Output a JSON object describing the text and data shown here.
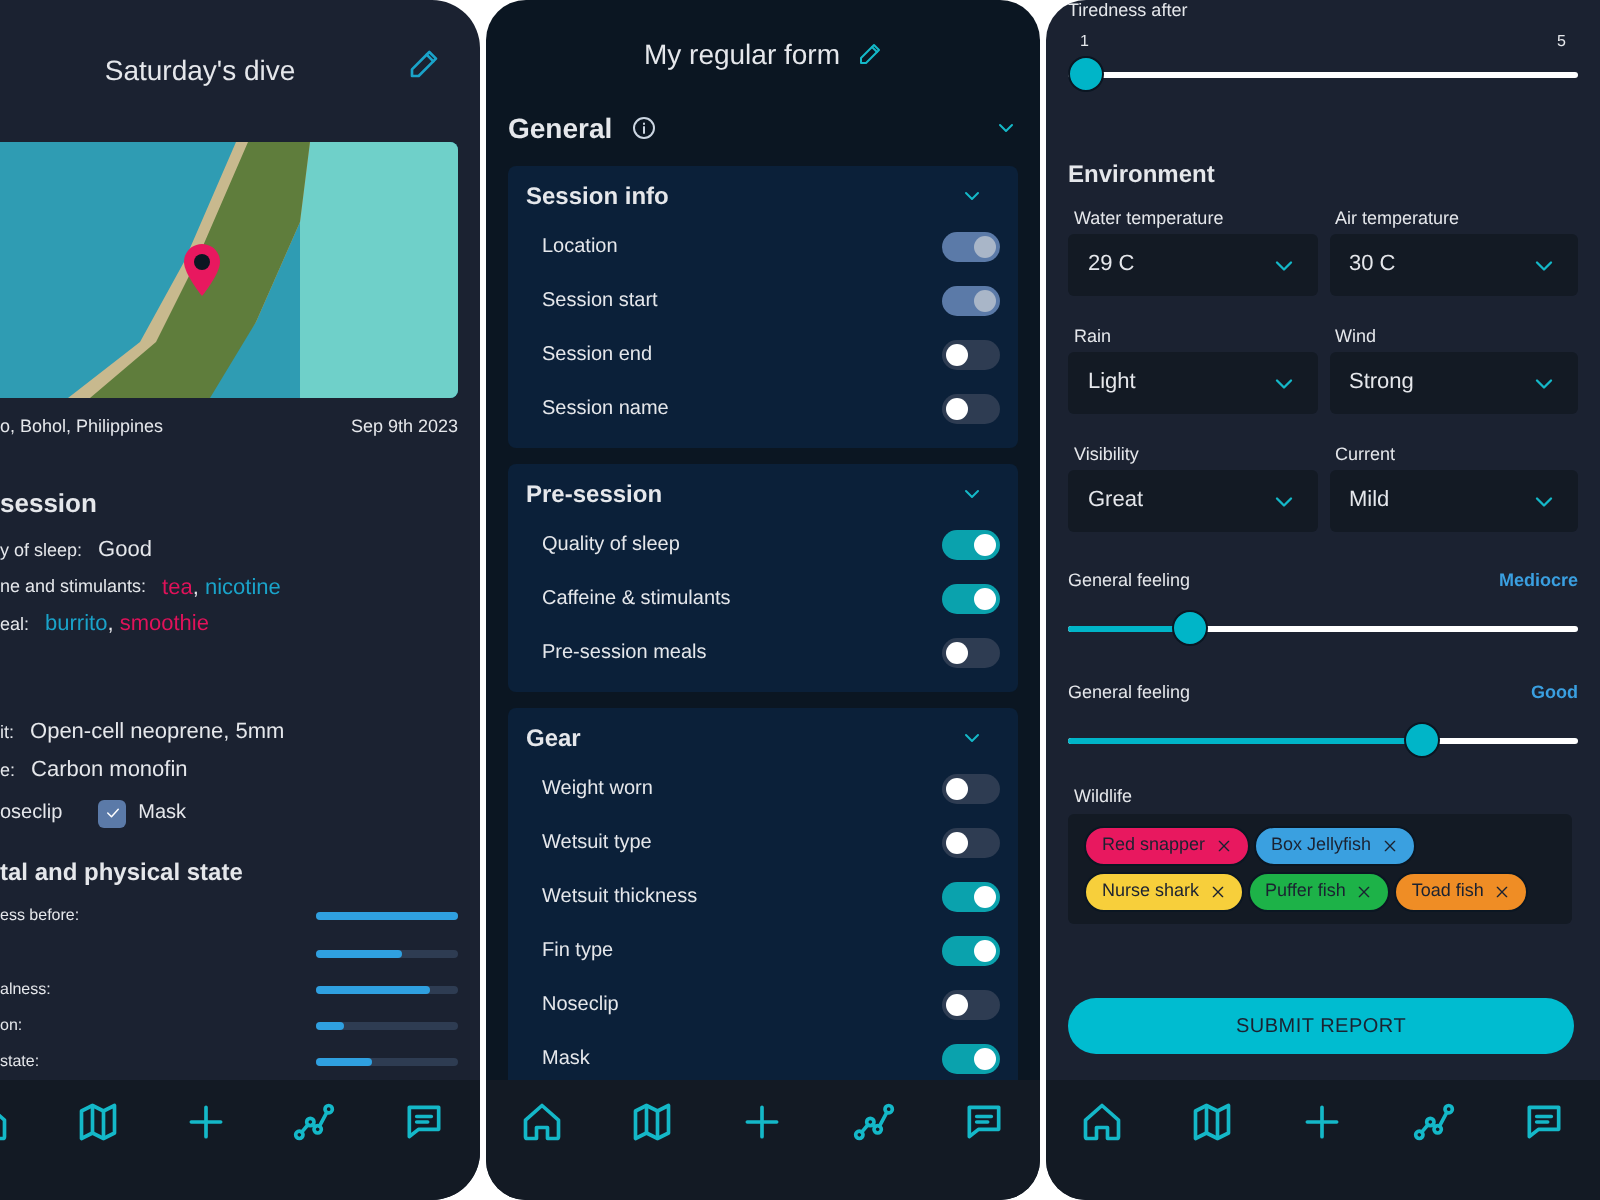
{
  "dive_summary": {
    "title": "Saturday's dive",
    "location": "o, Bohol, Philippines",
    "date": "Sep 9th 2023",
    "pre_session": {
      "heading": "session",
      "rows": [
        {
          "label": "y of sleep:",
          "values": [
            {
              "text": "Good"
            }
          ]
        },
        {
          "label": "ne and stimulants:",
          "separator": ",",
          "values": [
            {
              "text": "tea",
              "color": "#e0125a"
            },
            {
              "text": "nicotine",
              "color": "#1aa3c9"
            }
          ]
        },
        {
          "label": "eal:",
          "separator": ",",
          "values": [
            {
              "text": "burrito",
              "color": "#1aa3c9"
            },
            {
              "text": "smoothie",
              "color": "#e0125a"
            }
          ]
        }
      ]
    },
    "gear": {
      "rows": [
        {
          "label": "it:",
          "values": [
            {
              "text": "Open-cell neoprene, 5mm"
            }
          ]
        },
        {
          "label": "e:",
          "values": [
            {
              "text": "Carbon monofin"
            }
          ]
        }
      ],
      "checks": [
        {
          "label": "oseclip"
        },
        {
          "label": "Mask",
          "checked": true
        }
      ]
    },
    "mental_state": {
      "heading": "tal and physical state",
      "bars": [
        {
          "label": "ess before:",
          "level": 1
        },
        {
          "level": 0.6
        },
        {
          "label": "alness:",
          "level": 0.8
        },
        {
          "label": "on:",
          "level": 0.2
        },
        {
          "label": "state:",
          "level": 0.4
        }
      ]
    }
  },
  "form_editor": {
    "title": "My regular form",
    "section": "General",
    "groups": [
      {
        "title": "Session info",
        "items": [
          {
            "label": "Location",
            "on": true,
            "disabled": true
          },
          {
            "label": "Session start",
            "on": true,
            "disabled": true
          },
          {
            "label": "Session end",
            "on": false,
            "disabled": false
          },
          {
            "label": "Session name",
            "on": false,
            "disabled": false
          }
        ]
      },
      {
        "title": "Pre-session",
        "items": [
          {
            "label": "Quality of sleep",
            "on": true,
            "disabled": false
          },
          {
            "label": "Caffeine & stimulants",
            "on": true,
            "disabled": false
          },
          {
            "label": "Pre-session meals",
            "on": false,
            "disabled": false
          }
        ]
      },
      {
        "title": "Gear",
        "items": [
          {
            "label": "Weight worn",
            "on": false,
            "disabled": false
          },
          {
            "label": "Wetsuit type",
            "on": false,
            "disabled": false
          },
          {
            "label": "Wetsuit thickness",
            "on": true,
            "disabled": false
          },
          {
            "label": "Fin type",
            "on": true,
            "disabled": false
          },
          {
            "label": "Noseclip",
            "on": false,
            "disabled": false
          },
          {
            "label": "Mask",
            "on": true,
            "disabled": false
          }
        ]
      }
    ]
  },
  "report_form": {
    "tiredness": {
      "label": "Tiredness after",
      "min": "1",
      "max": "5",
      "level": 0
    },
    "environment": {
      "heading": "Environment",
      "fields": [
        {
          "label": "Water temperature",
          "value": "29 C"
        },
        {
          "label": "Air temperature",
          "value": "30 C"
        },
        {
          "label": "Rain",
          "value": "Light"
        },
        {
          "label": "Wind",
          "value": "Strong"
        },
        {
          "label": "Visibility",
          "value": "Great"
        },
        {
          "label": "Current",
          "value": "Mild"
        }
      ]
    },
    "feelings": [
      {
        "label": "General feeling",
        "reading": "Mediocre",
        "level": 0.22
      },
      {
        "label": "General feeling",
        "reading": "Good",
        "level": 0.71
      }
    ],
    "wildlife": {
      "label": "Wildlife",
      "tags": [
        {
          "text": "Red snapper",
          "color": "#e8185f"
        },
        {
          "text": "Box Jellyfish",
          "color": "#3aa0e0"
        },
        {
          "text": "Nurse shark",
          "color": "#f7cf3b"
        },
        {
          "text": "Puffer fish",
          "color": "#1db248"
        },
        {
          "text": "Toad fish",
          "color": "#ef8d25"
        }
      ]
    },
    "submit": "SUBMIT REPORT"
  }
}
